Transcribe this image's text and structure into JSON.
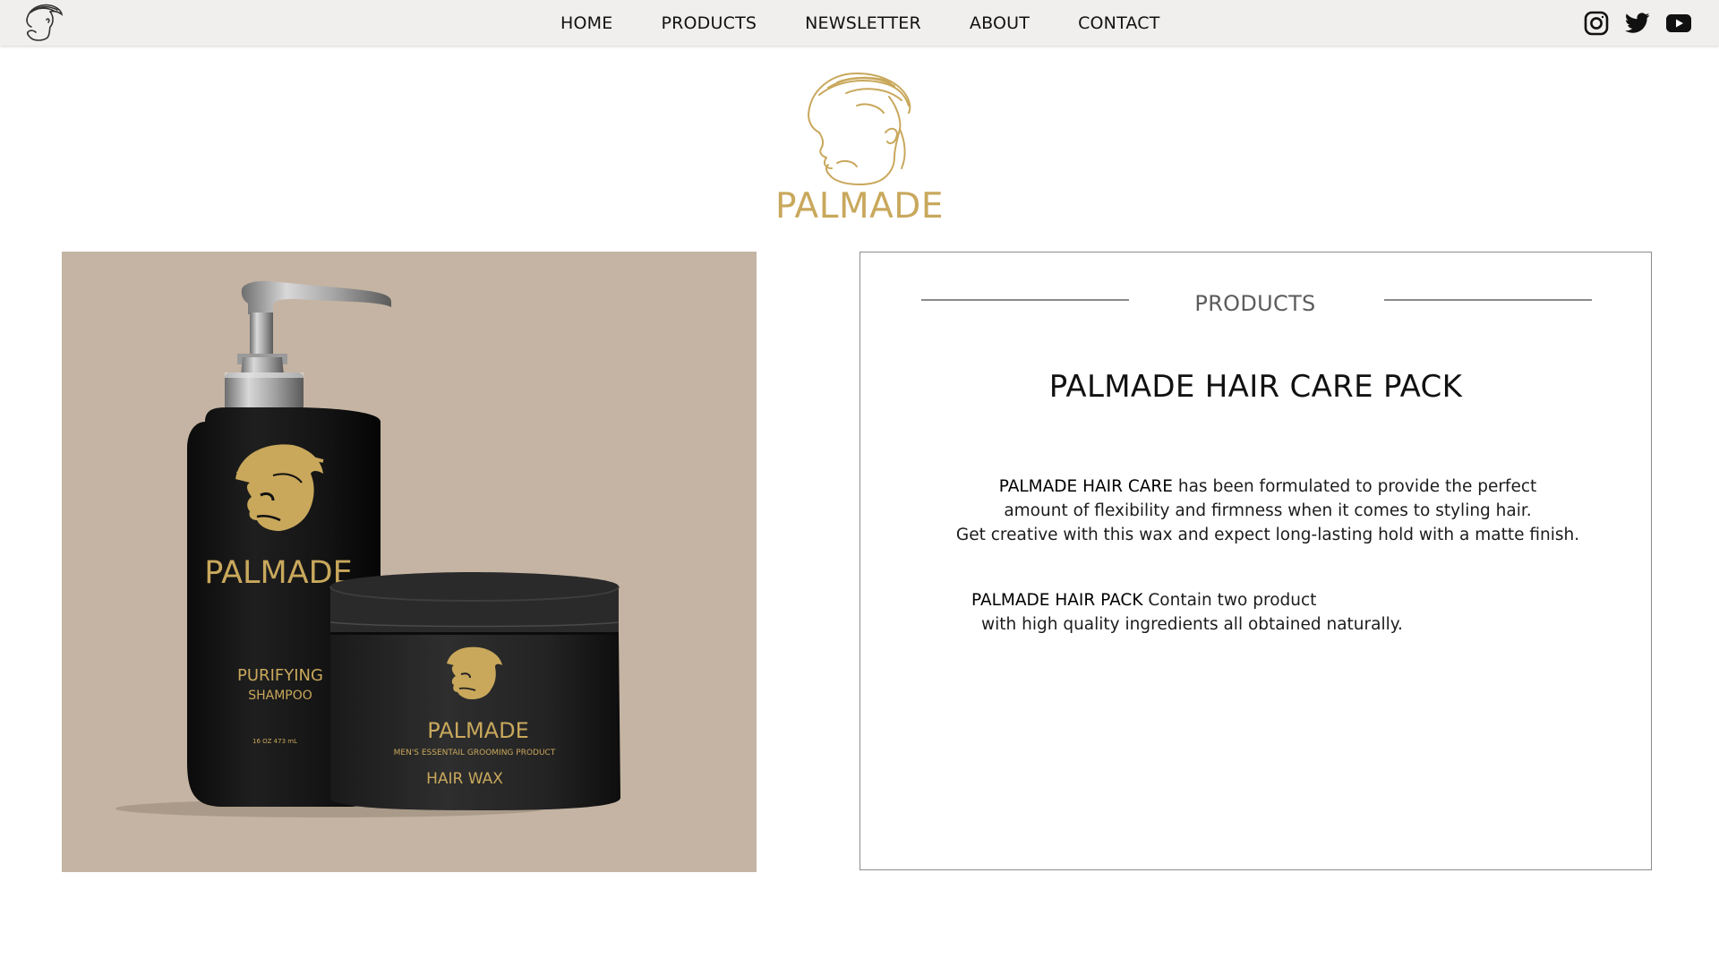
{
  "nav": {
    "logo_icon": "man-profile-logo-icon",
    "links": [
      "HOME",
      "PRODUCTS",
      "NEWSLETTER",
      "ABOUT",
      "CONTACT"
    ],
    "social": [
      "instagram-icon",
      "twitter-icon",
      "youtube-icon"
    ]
  },
  "hero": {
    "brand": "PALMADE",
    "brand_color": "#c9a85c"
  },
  "product_image": {
    "background": "#c5b4a3",
    "bottle": {
      "brand": "PALMADE",
      "line1": "PURIFYING",
      "line2": "SHAMPOO",
      "volume": "16 OZ 473 mL"
    },
    "jar": {
      "brand": "PALMADE",
      "tagline": "MEN'S ESSENTAIL GROOMING PRODUCT",
      "product": "HAIR WAX"
    }
  },
  "card": {
    "section": "PRODUCTS",
    "title": "PALMADE HAIR CARE PACK",
    "para1": {
      "strong": "PALMADE HAIR CARE",
      "line1_rest": " has been formulated to provide the perfect",
      "line2": "amount of flexibility and firmness when it comes to styling hair.",
      "line3": "Get creative with this wax and expect long-lasting hold with a matte finish."
    },
    "para2": {
      "strong": "PALMADE HAIR PACK",
      "line1_rest": " Contain two product",
      "line2": "with high quality ingredients all obtained naturally."
    }
  }
}
